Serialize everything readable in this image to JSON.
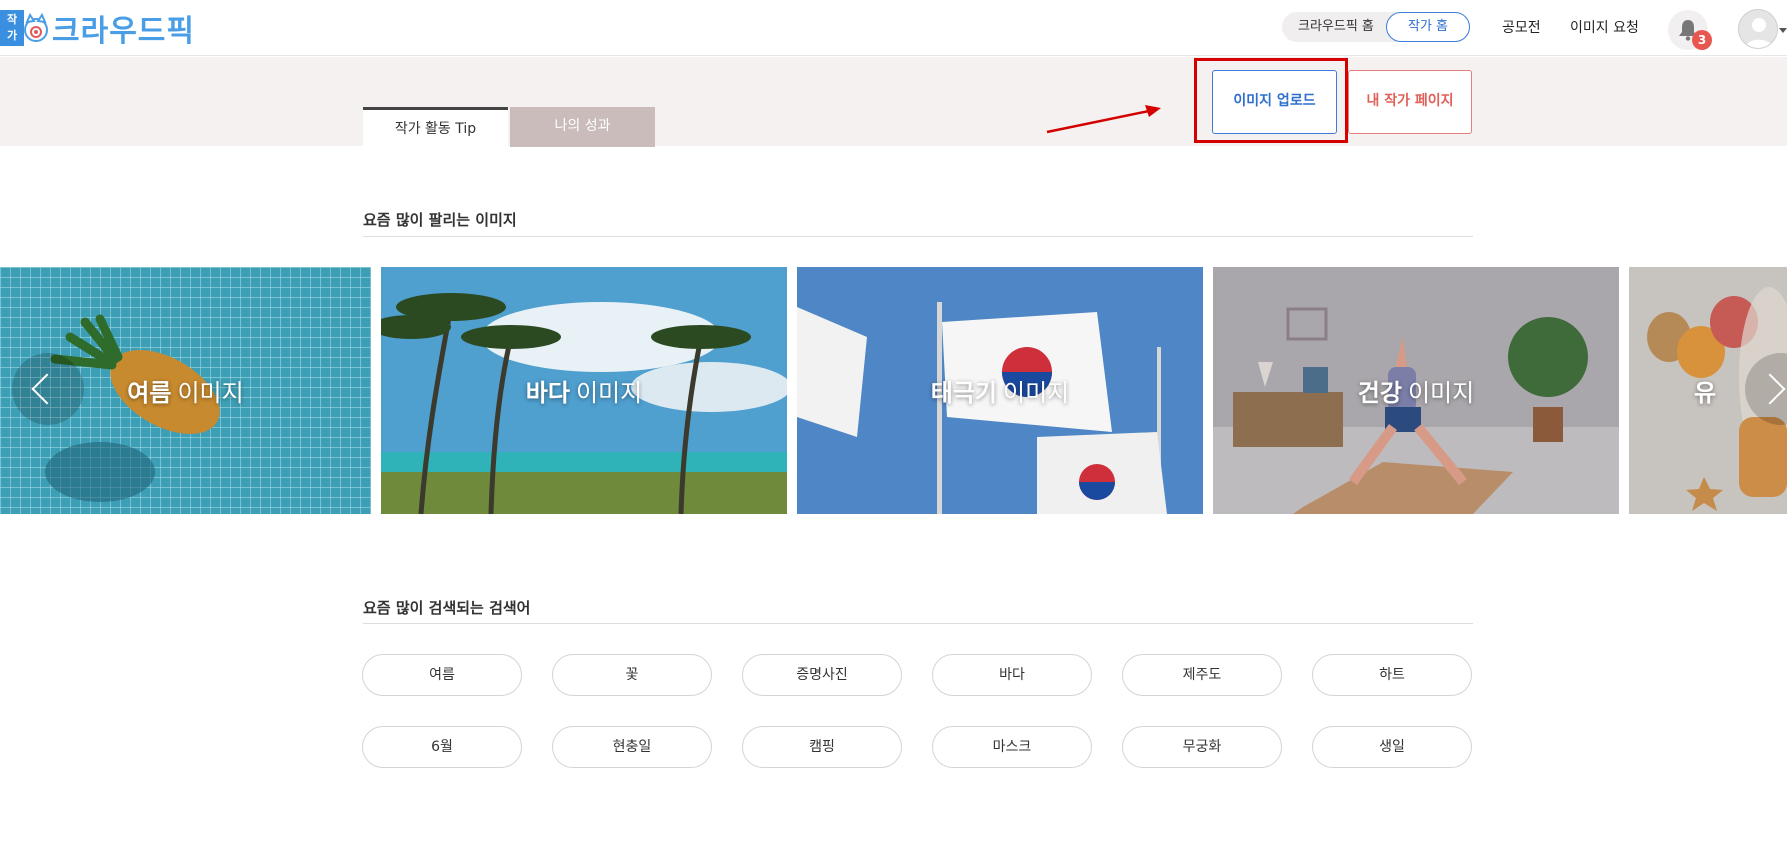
{
  "header": {
    "logo_badge_text": "작\n가",
    "logo_text": "크라우드픽",
    "segment_home": "크라우드픽 홈",
    "segment_artist": "작가 홈",
    "nav_contest": "공모전",
    "nav_image_request": "이미지 요청",
    "notification_count": "3"
  },
  "band": {
    "tabs": [
      {
        "label": "작가 활동 Tip",
        "active": true
      },
      {
        "label": "나의 성과",
        "active": false
      }
    ],
    "upload_button": "이미지 업로드",
    "mypage_button": "내 작가 페이지"
  },
  "popular_images": {
    "title": "요즘 많이 팔리는 이미지",
    "cards": [
      {
        "bold": "여름",
        "light": "이미지"
      },
      {
        "bold": "바다",
        "light": "이미지"
      },
      {
        "bold": "태극기",
        "light": "이미지"
      },
      {
        "bold": "건강",
        "light": "이미지"
      },
      {
        "bold": "유",
        "light": ""
      }
    ]
  },
  "popular_keywords": {
    "title": "요즘 많이 검색되는 검색어",
    "row1": [
      "여름",
      "꽃",
      "증명사진",
      "바다",
      "제주도",
      "하트"
    ],
    "row2": [
      "6월",
      "현충일",
      "캠핑",
      "마스크",
      "무궁화",
      "생일"
    ]
  },
  "colors": {
    "brand_blue": "#3b7dd8",
    "accent_red": "#e0605a",
    "highlight": "#d40000",
    "band_bg": "#f4f1f0"
  }
}
